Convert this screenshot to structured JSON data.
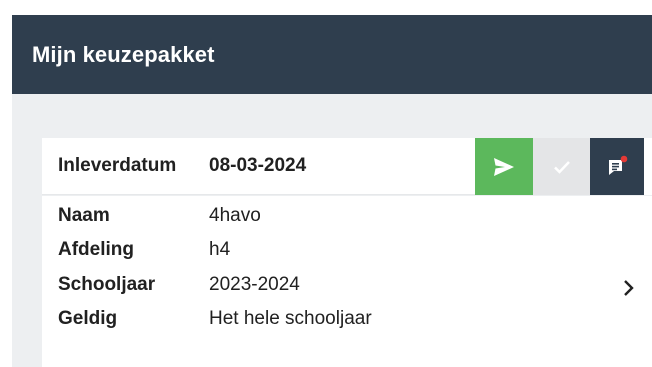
{
  "header": {
    "title": "Mijn keuzepakket"
  },
  "package": {
    "due_label": "Inleverdatum",
    "due_date": "08-03-2024",
    "actions": [
      {
        "name": "send-button",
        "icon": "send-icon",
        "color": "#5cb85c"
      },
      {
        "name": "confirm-button",
        "icon": "check-icon",
        "color": "#e4e5e7"
      },
      {
        "name": "messages-button",
        "icon": "comment-notification-icon",
        "color": "#2f3e4e",
        "badge_color": "#e53935"
      }
    ],
    "fields": [
      {
        "label": "Naam",
        "value": "4havo"
      },
      {
        "label": "Afdeling",
        "value": "h4"
      },
      {
        "label": "Schooljaar",
        "value": "2023-2024"
      },
      {
        "label": "Geldig",
        "value": "Het hele schooljaar"
      }
    ]
  },
  "colors": {
    "header_bg": "#2f3e4e",
    "page_bg": "#edeff1",
    "accent_green": "#5cb85c"
  }
}
